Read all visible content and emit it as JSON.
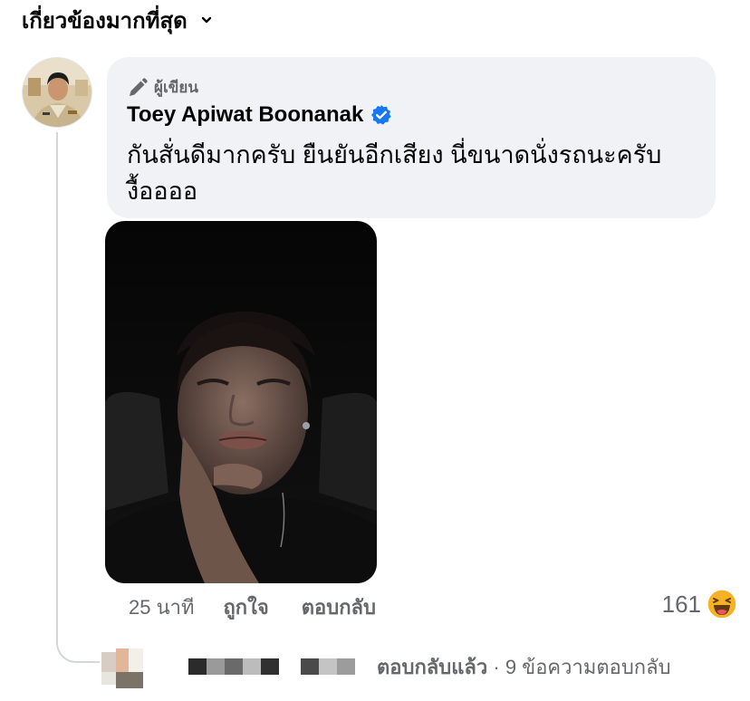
{
  "sort": {
    "label": "เกี่ยวข้องมากที่สุด",
    "icon": "chevron-down-icon"
  },
  "comment": {
    "badge": {
      "icon": "pen-icon",
      "label": "ผู้เขียน"
    },
    "author": "Toey Apiwat Boonanak",
    "verified_icon": "verified-badge-icon",
    "text_line1": "กันสั่นดีมากครับ ยืนยันอีกเสียง นี่ขนาดนั่งรถนะครับ",
    "text_line2": "งื้ออออ",
    "photo": "photo-of-person-sleeping-in-car"
  },
  "actions": {
    "time": "25 นาที",
    "like": "ถูกใจ",
    "reply": "ตอบกลับ"
  },
  "reactions": {
    "count": "161",
    "icon": "haha-reaction-icon"
  },
  "reply_summary": {
    "action": "ตอบกลับแล้ว",
    "separator": " · ",
    "count_text": "9 ข้อความตอบกลับ"
  },
  "colors": {
    "text": "#050505",
    "secondary": "#65676b",
    "bubble": "#f0f2f5",
    "verified": "#1877f2",
    "reaction": "#f7b125"
  }
}
